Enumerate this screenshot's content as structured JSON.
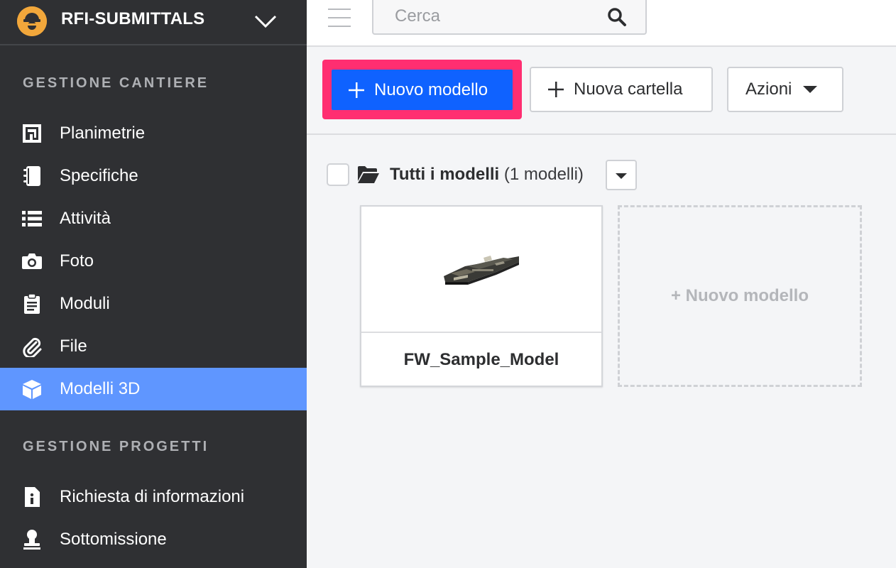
{
  "project": {
    "name": "RFI-SUBMITTALS"
  },
  "sidebar": {
    "sections": [
      {
        "title": "GESTIONE CANTIERE"
      },
      {
        "title": "GESTIONE PROGETTI"
      }
    ],
    "items": [
      {
        "label": "Planimetrie",
        "icon": "floorplan-icon"
      },
      {
        "label": "Specifiche",
        "icon": "notebook-icon"
      },
      {
        "label": "Attività",
        "icon": "list-icon"
      },
      {
        "label": "Foto",
        "icon": "camera-icon"
      },
      {
        "label": "Moduli",
        "icon": "clipboard-icon"
      },
      {
        "label": "File",
        "icon": "paperclip-icon"
      },
      {
        "label": "Modelli 3D",
        "icon": "cube-icon",
        "active": true
      },
      {
        "label": "Richiesta di informazioni",
        "icon": "info-document-icon"
      },
      {
        "label": "Sottomissione",
        "icon": "stamp-icon"
      }
    ]
  },
  "search": {
    "placeholder": "Cerca"
  },
  "toolbar": {
    "new_model_label": "Nuovo modello",
    "new_folder_label": "Nuova cartella",
    "actions_label": "Azioni"
  },
  "folder": {
    "title": "Tutti i modelli",
    "count_text": "(1 modelli)"
  },
  "models": [
    {
      "name": "FW_Sample_Model"
    }
  ],
  "new_model_card_label": "+ Nuovo modello",
  "colors": {
    "sidebar_bg": "#2f3033",
    "active_item": "#5f96ff",
    "primary_button": "#0f62ff",
    "highlight": "#ff2e71",
    "logo": "#f2a73b"
  }
}
